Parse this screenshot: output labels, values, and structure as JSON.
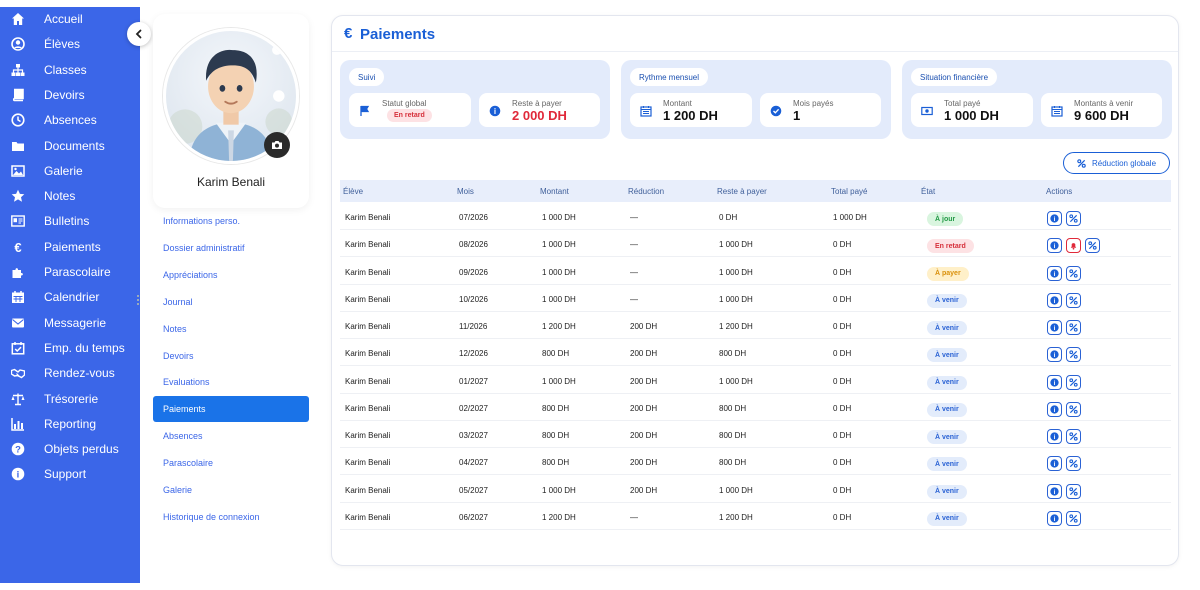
{
  "sidebar": {
    "items": [
      {
        "label": "Accueil",
        "icon": "home-icon"
      },
      {
        "label": "Élèves",
        "icon": "user-circle-icon"
      },
      {
        "label": "Classes",
        "icon": "hierarchy-icon"
      },
      {
        "label": "Devoirs",
        "icon": "book-icon"
      },
      {
        "label": "Absences",
        "icon": "clock-icon"
      },
      {
        "label": "Documents",
        "icon": "folder-icon"
      },
      {
        "label": "Galerie",
        "icon": "image-icon"
      },
      {
        "label": "Notes",
        "icon": "star-icon"
      },
      {
        "label": "Bulletins",
        "icon": "id-card-icon"
      },
      {
        "label": "Paiements",
        "icon": "euro-icon"
      },
      {
        "label": "Parascolaire",
        "icon": "puzzle-icon"
      },
      {
        "label": "Calendrier",
        "icon": "calendar-icon"
      },
      {
        "label": "Messagerie",
        "icon": "envelope-icon"
      },
      {
        "label": "Emp. du temps",
        "icon": "calendar-check-icon"
      },
      {
        "label": "Rendez-vous",
        "icon": "handshake-icon"
      },
      {
        "label": "Trésorerie",
        "icon": "scale-icon"
      },
      {
        "label": "Reporting",
        "icon": "bar-chart-icon"
      },
      {
        "label": "Objets perdus",
        "icon": "question-icon"
      },
      {
        "label": "Support",
        "icon": "info-icon"
      }
    ]
  },
  "profile": {
    "name": "Karim Benali"
  },
  "profile_menu": [
    {
      "label": "Informations perso.",
      "active": false
    },
    {
      "label": "Dossier administratif",
      "active": false
    },
    {
      "label": "Appréciations",
      "active": false
    },
    {
      "label": "Journal",
      "active": false
    },
    {
      "label": "Notes",
      "active": false
    },
    {
      "label": "Devoirs",
      "active": false
    },
    {
      "label": "Evaluations",
      "active": false
    },
    {
      "label": "Paiements",
      "active": true
    },
    {
      "label": "Absences",
      "active": false
    },
    {
      "label": "Parascolaire",
      "active": false
    },
    {
      "label": "Galerie",
      "active": false
    },
    {
      "label": "Historique de connexion",
      "active": false
    }
  ],
  "main": {
    "title_icon": "€",
    "title": "Paiements",
    "summary": [
      {
        "title": "Suivi",
        "stats": [
          {
            "label": "Statut global",
            "badge": "En retard",
            "icon": "flag-icon"
          },
          {
            "label": "Reste à payer",
            "value": "2 000 DH",
            "icon": "info-icon",
            "value_color": "#e0293a"
          }
        ]
      },
      {
        "title": "Rythme mensuel",
        "stats": [
          {
            "label": "Montant",
            "value": "1 200 DH",
            "icon": "calendar-icon"
          },
          {
            "label": "Mois payés",
            "value": "1",
            "icon": "check-circle-icon"
          }
        ]
      },
      {
        "title": "Situation financière",
        "stats": [
          {
            "label": "Total payé",
            "value": "1 000 DH",
            "icon": "money-icon"
          },
          {
            "label": "Montants à venir",
            "value": "9 600 DH",
            "icon": "calendar-icon"
          }
        ]
      }
    ],
    "discount_button": "Réduction globale",
    "table": {
      "columns": [
        "Élève",
        "Mois",
        "Montant",
        "Réduction",
        "Reste à payer",
        "Total payé",
        "État",
        "Actions"
      ],
      "rows": [
        {
          "student": "Karim Benali",
          "month": "07/2026",
          "amount": "1 000 DH",
          "reduction": "—",
          "remaining": "0 DH",
          "paid": "1 000 DH",
          "state": "À jour",
          "state_color": "green",
          "actions": [
            "info-icon",
            "percent-icon"
          ]
        },
        {
          "student": "Karim Benali",
          "month": "08/2026",
          "amount": "1 000 DH",
          "reduction": "—",
          "remaining": "1 000 DH",
          "paid": "0 DH",
          "state": "En retard",
          "state_color": "red",
          "actions": [
            "info-icon",
            "bell-icon",
            "percent-icon"
          ]
        },
        {
          "student": "Karim Benali",
          "month": "09/2026",
          "amount": "1 000 DH",
          "reduction": "—",
          "remaining": "1 000 DH",
          "paid": "0 DH",
          "state": "À payer",
          "state_color": "orange",
          "actions": [
            "info-icon",
            "percent-icon"
          ]
        },
        {
          "student": "Karim Benali",
          "month": "10/2026",
          "amount": "1 000 DH",
          "reduction": "—",
          "remaining": "1 000 DH",
          "paid": "0 DH",
          "state": "À venir",
          "state_color": "blue",
          "actions": [
            "info-icon",
            "percent-icon"
          ]
        },
        {
          "student": "Karim Benali",
          "month": "11/2026",
          "amount": "1 200 DH",
          "reduction": "200 DH",
          "remaining": "1 200 DH",
          "paid": "0 DH",
          "state": "À venir",
          "state_color": "blue",
          "actions": [
            "info-icon",
            "percent-icon"
          ]
        },
        {
          "student": "Karim Benali",
          "month": "12/2026",
          "amount": "800 DH",
          "reduction": "200 DH",
          "remaining": "800 DH",
          "paid": "0 DH",
          "state": "À venir",
          "state_color": "blue",
          "actions": [
            "info-icon",
            "percent-icon"
          ]
        },
        {
          "student": "Karim Benali",
          "month": "01/2027",
          "amount": "1 000 DH",
          "reduction": "200 DH",
          "remaining": "1 000 DH",
          "paid": "0 DH",
          "state": "À venir",
          "state_color": "blue",
          "actions": [
            "info-icon",
            "percent-icon"
          ]
        },
        {
          "student": "Karim Benali",
          "month": "02/2027",
          "amount": "800 DH",
          "reduction": "200 DH",
          "remaining": "800 DH",
          "paid": "0 DH",
          "state": "À venir",
          "state_color": "blue",
          "actions": [
            "info-icon",
            "percent-icon"
          ]
        },
        {
          "student": "Karim Benali",
          "month": "03/2027",
          "amount": "800 DH",
          "reduction": "200 DH",
          "remaining": "800 DH",
          "paid": "0 DH",
          "state": "À venir",
          "state_color": "blue",
          "actions": [
            "info-icon",
            "percent-icon"
          ]
        },
        {
          "student": "Karim Benali",
          "month": "04/2027",
          "amount": "800 DH",
          "reduction": "200 DH",
          "remaining": "800 DH",
          "paid": "0 DH",
          "state": "À venir",
          "state_color": "blue",
          "actions": [
            "info-icon",
            "percent-icon"
          ]
        },
        {
          "student": "Karim Benali",
          "month": "05/2027",
          "amount": "1 000 DH",
          "reduction": "200 DH",
          "remaining": "1 000 DH",
          "paid": "0 DH",
          "state": "À venir",
          "state_color": "blue",
          "actions": [
            "info-icon",
            "percent-icon"
          ]
        },
        {
          "student": "Karim Benali",
          "month": "06/2027",
          "amount": "1 200 DH",
          "reduction": "—",
          "remaining": "1 200 DH",
          "paid": "0 DH",
          "state": "À venir",
          "state_color": "blue",
          "actions": [
            "info-icon",
            "percent-icon"
          ]
        }
      ]
    }
  }
}
